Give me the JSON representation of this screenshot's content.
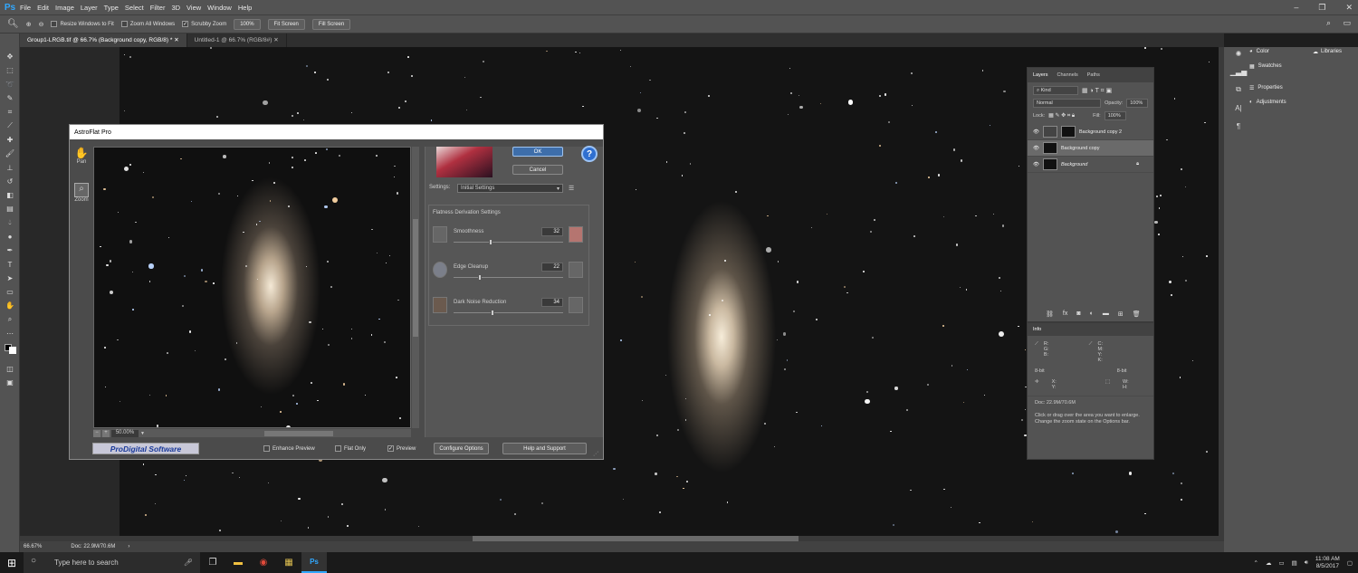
{
  "app": {
    "logo": "Ps",
    "menus": [
      "File",
      "Edit",
      "Image",
      "Layer",
      "Type",
      "Select",
      "Filter",
      "3D",
      "View",
      "Window",
      "Help"
    ]
  },
  "options": {
    "resize": "Resize Windows to Fit",
    "zoom_all": "Zoom All Windows",
    "scrubby": "Scrubby Zoom",
    "pct": "100%",
    "fit": "Fit Screen",
    "fill": "Fill Screen"
  },
  "tabs": [
    {
      "label": "Group1-LRGB.tif @ 66.7% (Background copy, RGB/8) *"
    },
    {
      "label": "Untitled-1 @ 66.7% (RGB/8#)"
    }
  ],
  "status": {
    "zoom": "66.67%",
    "doc": "Doc: 22.9M/70.6M"
  },
  "dock": {
    "color": "Color",
    "swatches": "Swatches",
    "properties": "Properties",
    "adjustments": "Adjustments",
    "libraries": "Libraries"
  },
  "layers_panel": {
    "tabs": [
      "Layers",
      "Channels",
      "Paths"
    ],
    "kind": "Kind",
    "blend": "Normal",
    "opacity_label": "Opacity:",
    "opacity": "100%",
    "lock_label": "Lock:",
    "fill_label": "Fill:",
    "fill": "100%",
    "layers": [
      "Background copy 2",
      "Background copy",
      "Background"
    ]
  },
  "info_panel": {
    "title": "Info",
    "rgb": "R:\nG:\nB:",
    "cmyk": "C:\nM:\nY:\nK:",
    "bit1": "8-bit",
    "bit2": "8-bit",
    "xy": "X:\nY:",
    "wh": "W:\nH:",
    "doc": "Doc: 22.9M/70.6M",
    "hint": "Click or drag over the area you want to enlarge. Change the zoom state on the Options bar."
  },
  "dialog": {
    "title": "AstroFlat Pro",
    "pan": "Pan",
    "zoom": "Zoom",
    "ok": "OK",
    "cancel": "Cancel",
    "help_glyph": "?",
    "settings_label": "Settings:",
    "settings_value": "Initial Settings",
    "group": "Flatness Derivation Settings",
    "sliders": [
      {
        "label": "Smoothness",
        "value": "32",
        "level": 0.32
      },
      {
        "label": "Edge Cleanup",
        "value": "22",
        "level": 0.22
      },
      {
        "label": "Dark Noise Reduction",
        "value": "34",
        "level": 0.34
      }
    ],
    "zoom_pct": "50.00%",
    "brand": "ProDigital Software",
    "enhance": "Enhance Preview",
    "flat_only": "Flat Only",
    "preview": "Preview",
    "configure": "Configure Options",
    "support": "Help and Support"
  },
  "taskbar": {
    "search": "Type here to search",
    "time": "11:08 AM",
    "date": "8/5/2017"
  }
}
